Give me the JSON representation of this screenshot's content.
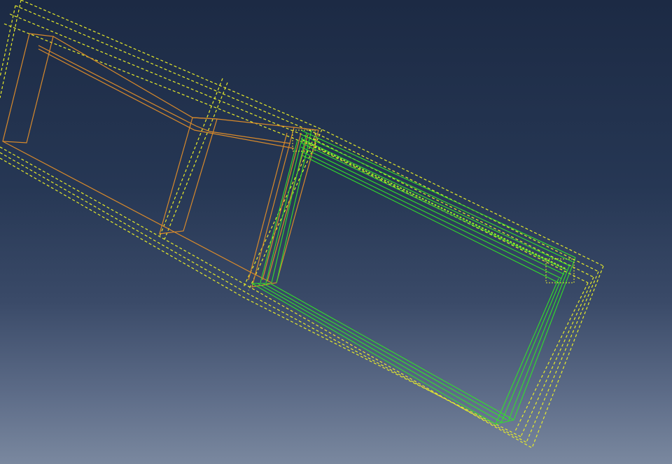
{
  "viewport": {
    "title": "",
    "background_top": "#1c2a44",
    "background_bottom": "#7a889f"
  },
  "colors": {
    "part_wire": "#d98a2b",
    "selected_wire": "#33e02a",
    "datum_dashed": "#e8ec2a"
  },
  "objects": [
    {
      "name": "outer-boundary",
      "style": "dashed",
      "color_key": "datum_dashed"
    },
    {
      "name": "left-part",
      "style": "solid",
      "color_key": "part_wire"
    },
    {
      "name": "right-part-selected",
      "style": "solid",
      "color_key": "selected_wire"
    }
  ]
}
